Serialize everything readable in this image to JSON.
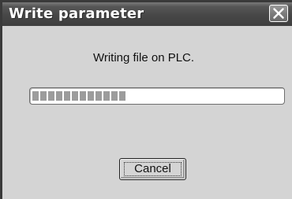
{
  "dialog": {
    "title": "Write parameter",
    "close_icon": "close-icon",
    "message": "Writing file on PLC.",
    "progress": {
      "fraction": 0.38,
      "segments_filled": 12
    },
    "cancel_label": "Cancel"
  },
  "colors": {
    "titlebar": "#474747",
    "title_text": "#ffffff",
    "dialog_background": "#d4d4d4",
    "progress_segment": "#9c9c9c"
  }
}
